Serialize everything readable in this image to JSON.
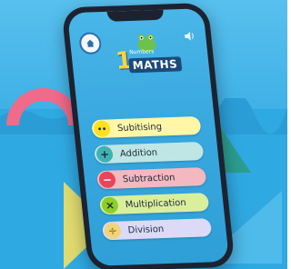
{
  "app": {
    "logo_number": "1",
    "logo_subtitle": "Numbers",
    "logo_title": "MATHS"
  },
  "topbar": {
    "home_icon": "home-icon",
    "sound_icon": "speaker-icon"
  },
  "menu": {
    "items": [
      {
        "label": "Subitising",
        "icon": "dots-icon",
        "glyph": "••"
      },
      {
        "label": "Addition",
        "icon": "plus-icon",
        "glyph": "+"
      },
      {
        "label": "Subtraction",
        "icon": "minus-icon",
        "glyph": "−"
      },
      {
        "label": "Multiplication",
        "icon": "times-icon",
        "glyph": "×"
      },
      {
        "label": "Division",
        "icon": "divide-icon",
        "glyph": "÷"
      }
    ]
  },
  "colors": {
    "background": "#2fa9e2",
    "subitising": "#ffe11f",
    "addition": "#3fb3b3",
    "subtraction": "#e8455b",
    "multiplication": "#8ccf2a",
    "division": "#f0d47a"
  }
}
